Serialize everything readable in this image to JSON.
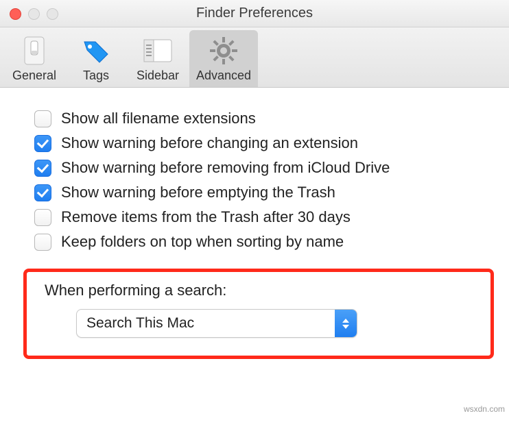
{
  "window": {
    "title": "Finder Preferences"
  },
  "toolbar": {
    "items": [
      {
        "label": "General",
        "selected": false
      },
      {
        "label": "Tags",
        "selected": false
      },
      {
        "label": "Sidebar",
        "selected": false
      },
      {
        "label": "Advanced",
        "selected": true
      }
    ]
  },
  "checkboxes": [
    {
      "label": "Show all filename extensions",
      "checked": false
    },
    {
      "label": "Show warning before changing an extension",
      "checked": true
    },
    {
      "label": "Show warning before removing from iCloud Drive",
      "checked": true
    },
    {
      "label": "Show warning before emptying the Trash",
      "checked": true
    },
    {
      "label": "Remove items from the Trash after 30 days",
      "checked": false
    },
    {
      "label": "Keep folders on top when sorting by name",
      "checked": false
    }
  ],
  "search": {
    "label": "When performing a search:",
    "value": "Search This Mac"
  },
  "watermark": "wsxdn.com",
  "colors": {
    "accent": "#1f7ef0",
    "highlight": "#ff2a1a"
  }
}
